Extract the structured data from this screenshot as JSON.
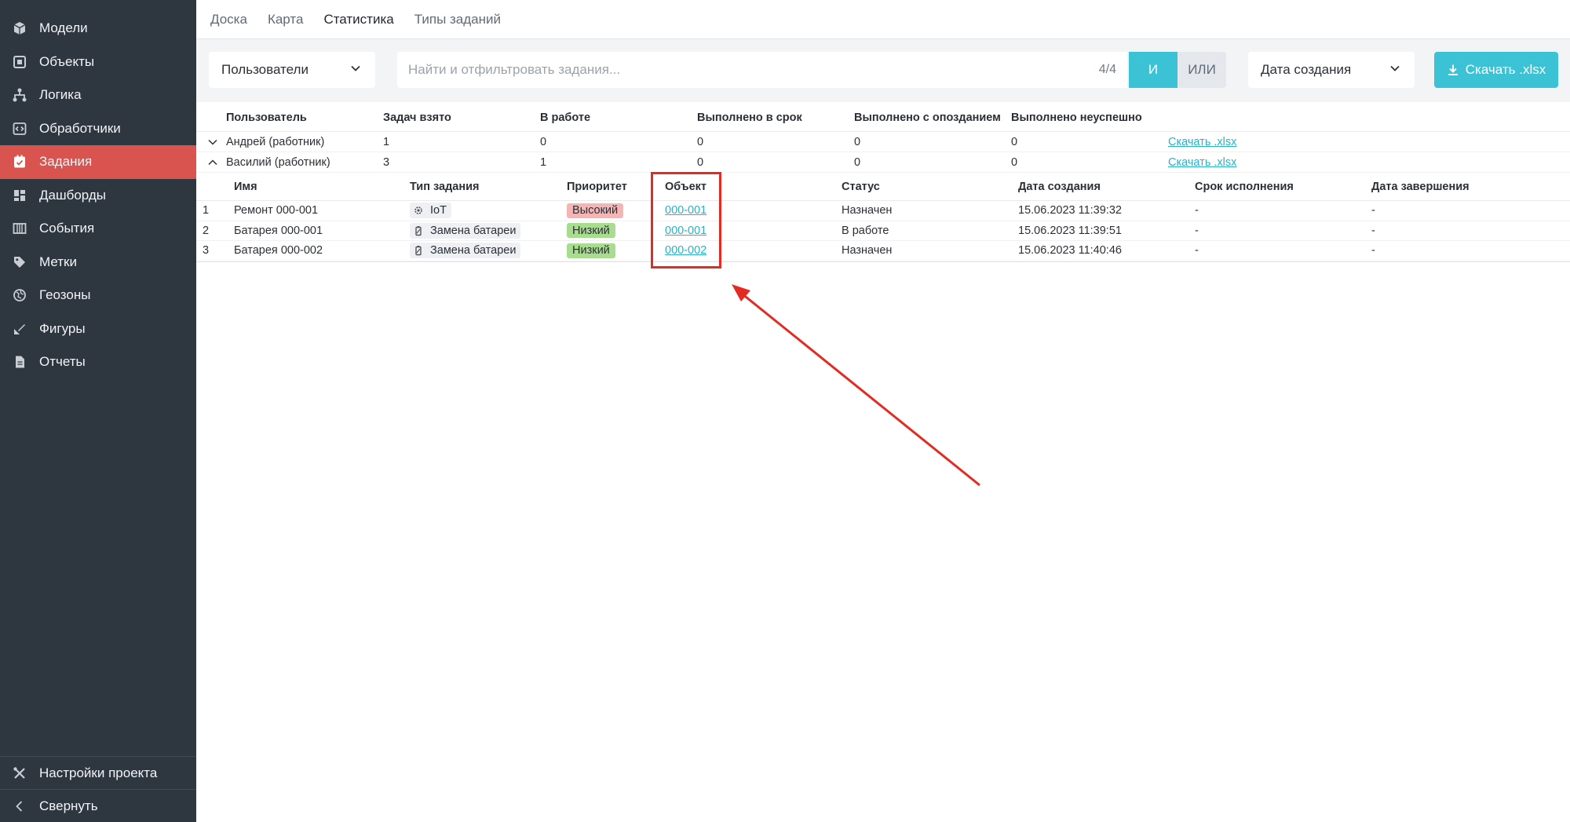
{
  "sidebar": {
    "items": [
      {
        "label": "Модели",
        "icon": "cube-icon"
      },
      {
        "label": "Объекты",
        "icon": "object-icon"
      },
      {
        "label": "Логика",
        "icon": "logic-icon"
      },
      {
        "label": "Обработчики",
        "icon": "handler-icon"
      },
      {
        "label": "Задания",
        "icon": "task-icon",
        "active": true
      },
      {
        "label": "Дашборды",
        "icon": "dashboard-icon"
      },
      {
        "label": "События",
        "icon": "events-icon"
      },
      {
        "label": "Метки",
        "icon": "tag-icon"
      },
      {
        "label": "Геозоны",
        "icon": "geozone-icon"
      },
      {
        "label": "Фигуры",
        "icon": "shapes-icon"
      },
      {
        "label": "Отчеты",
        "icon": "report-icon"
      }
    ],
    "settings_label": "Настройки проекта",
    "collapse_label": "Свернуть"
  },
  "tabs": [
    {
      "label": "Доска"
    },
    {
      "label": "Карта"
    },
    {
      "label": "Статистика",
      "active": true
    },
    {
      "label": "Типы заданий"
    }
  ],
  "filter": {
    "users_select": "Пользователи",
    "search_placeholder": "Найти и отфильтровать задания...",
    "search_count": "4/4",
    "and_label": "И",
    "or_label": "ИЛИ",
    "date_select": "Дата создания",
    "download_label": "Скачать .xlsx"
  },
  "summary": {
    "headers": [
      "Пользователь",
      "Задач взято",
      "В работе",
      "Выполнено в срок",
      "Выполнено с опозданием",
      "Выполнено неуспешно"
    ],
    "rows": [
      {
        "user": "Андрей (работник)",
        "taken": "1",
        "in_work": "0",
        "on_time": "0",
        "late": "0",
        "failed": "0",
        "link": "Скачать .xlsx",
        "expanded": false
      },
      {
        "user": "Василий (работник)",
        "taken": "3",
        "in_work": "1",
        "on_time": "0",
        "late": "0",
        "failed": "0",
        "link": "Скачать .xlsx",
        "expanded": true
      }
    ]
  },
  "details": {
    "headers": [
      "Имя",
      "Тип задания",
      "Приоритет",
      "Объект",
      "Статус",
      "Дата создания",
      "Срок исполнения",
      "Дата завершения"
    ],
    "rows": [
      {
        "num": "1",
        "name": "Ремонт 000-001",
        "type": "IoT",
        "type_icon": "gear-icon",
        "priority": "Высокий",
        "priority_color": "#f4b6b4",
        "object": "000-001",
        "status": "Назначен",
        "created": "15.06.2023 11:39:32",
        "deadline": "-",
        "finished": "-"
      },
      {
        "num": "2",
        "name": "Батарея 000-001",
        "type": "Замена батареи",
        "type_icon": "battery-icon",
        "priority": "Низкий",
        "priority_color": "#a8dc8f",
        "object": "000-001",
        "status": "В работе",
        "created": "15.06.2023 11:39:51",
        "deadline": "-",
        "finished": "-"
      },
      {
        "num": "3",
        "name": "Батарея 000-002",
        "type": "Замена батареи",
        "type_icon": "battery-icon",
        "priority": "Низкий",
        "priority_color": "#a8dc8f",
        "object": "000-002",
        "status": "Назначен",
        "created": "15.06.2023 11:40:46",
        "deadline": "-",
        "finished": "-"
      }
    ]
  },
  "colors": {
    "sidebar_bg": "#2e3640",
    "active_item": "#d9534f",
    "accent": "#3cc2d5",
    "annotation": "#e32b22"
  }
}
